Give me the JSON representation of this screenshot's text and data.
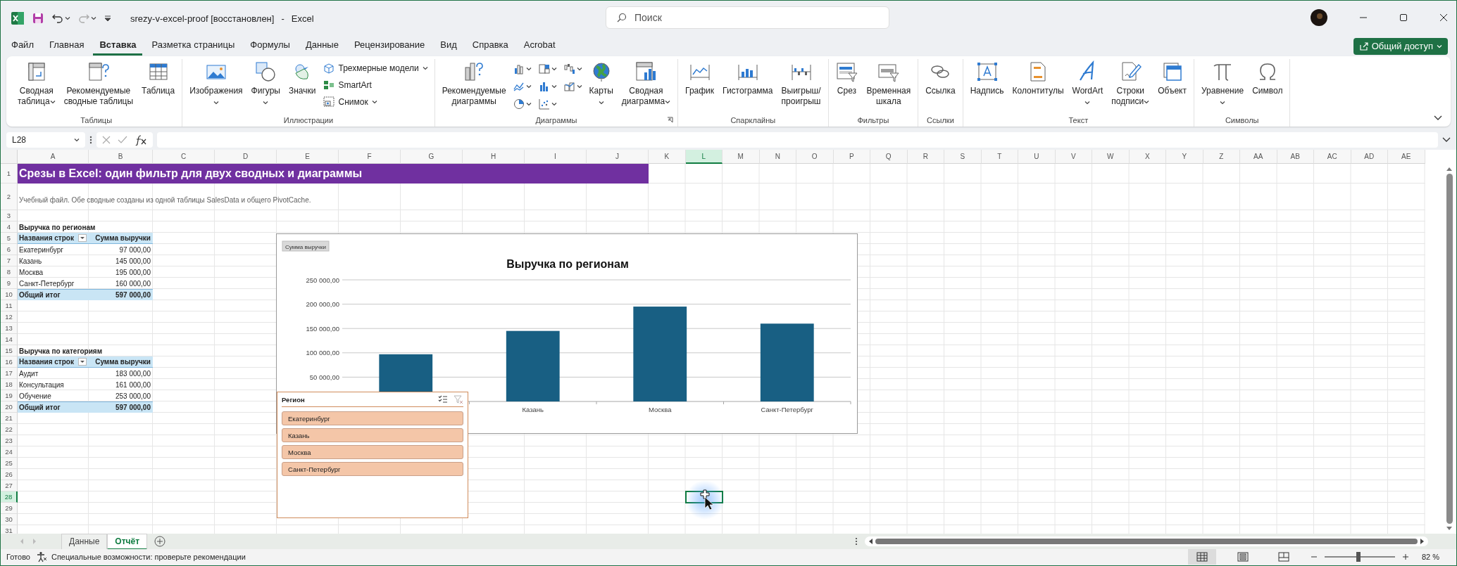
{
  "window": {
    "file_name": "srezy-v-excel-proof [восстановлен]",
    "separator": "-",
    "app_name": "Excel"
  },
  "search": {
    "placeholder": "Поиск"
  },
  "share_button": {
    "label": "Общий доступ"
  },
  "menu_tabs": [
    {
      "label": "Файл",
      "selected": false
    },
    {
      "label": "Главная",
      "selected": false
    },
    {
      "label": "Вставка",
      "selected": true
    },
    {
      "label": "Разметка страницы",
      "selected": false
    },
    {
      "label": "Формулы",
      "selected": false
    },
    {
      "label": "Данные",
      "selected": false
    },
    {
      "label": "Рецензирование",
      "selected": false
    },
    {
      "label": "Вид",
      "selected": false
    },
    {
      "label": "Справка",
      "selected": false
    },
    {
      "label": "Acrobat",
      "selected": false
    }
  ],
  "ribbon": {
    "groups": [
      {
        "label": "Таблицы",
        "launcher": false,
        "items": [
          {
            "kind": "large",
            "label": "Сводная\nтаблица",
            "dropdown": true
          },
          {
            "kind": "large",
            "label": "Рекомендуемые\nсводные таблицы",
            "dropdown": false
          },
          {
            "kind": "large",
            "label": "Таблица",
            "dropdown": false
          }
        ]
      },
      {
        "label": "Иллюстрации",
        "launcher": false,
        "items": [
          {
            "kind": "large",
            "label": "Изображения",
            "dropdown": true
          },
          {
            "kind": "large",
            "label": "Фигуры",
            "dropdown": true
          },
          {
            "kind": "large",
            "label": "Значки",
            "dropdown": false
          },
          {
            "kind": "stack",
            "items": [
              {
                "label": "Трехмерные модели",
                "dropdown": true
              },
              {
                "label": "SmartArt",
                "dropdown": false
              },
              {
                "label": "Снимок",
                "dropdown": true
              }
            ]
          }
        ]
      },
      {
        "label": "Диаграммы",
        "launcher": true,
        "items": [
          {
            "kind": "large",
            "label": "Рекомендуемые\nдиаграммы",
            "dropdown": false
          },
          {
            "kind": "icon_grid",
            "items": [
              {
                "dropdown": true
              },
              {
                "dropdown": true
              },
              {
                "dropdown": true
              },
              {
                "dropdown": true
              },
              {
                "dropdown": true
              },
              {
                "dropdown": true
              },
              {
                "dropdown": true
              },
              {
                "dropdown": true
              }
            ]
          },
          {
            "kind": "large",
            "label": "Карты",
            "dropdown": true
          },
          {
            "kind": "large",
            "label": "Сводная\nдиаграмма",
            "dropdown": true
          }
        ]
      },
      {
        "label": "Спарклайны",
        "launcher": false,
        "items": [
          {
            "kind": "large",
            "label": "График",
            "dropdown": false
          },
          {
            "kind": "large",
            "label": "Гистограмма",
            "dropdown": false
          },
          {
            "kind": "large",
            "label": "Выигрыш/\nпроигрыш",
            "dropdown": false
          }
        ]
      },
      {
        "label": "Фильтры",
        "launcher": false,
        "items": [
          {
            "kind": "large",
            "label": "Срез",
            "dropdown": false
          },
          {
            "kind": "large",
            "label": "Временная\nшкала",
            "dropdown": false
          }
        ]
      },
      {
        "label": "Ссылки",
        "launcher": false,
        "items": [
          {
            "kind": "large",
            "label": "Ссылка",
            "dropdown": false
          }
        ]
      },
      {
        "label": "Текст",
        "launcher": false,
        "items": [
          {
            "kind": "large",
            "label": "Надпись",
            "dropdown": false
          },
          {
            "kind": "large",
            "label": "Колонтитулы",
            "dropdown": false
          },
          {
            "kind": "large",
            "label": "WordArt",
            "dropdown": true
          },
          {
            "kind": "large",
            "label": "Строки\nподписи",
            "dropdown": true
          },
          {
            "kind": "large",
            "label": "Объект",
            "dropdown": false
          }
        ]
      },
      {
        "label": "Символы",
        "launcher": false,
        "items": [
          {
            "kind": "large",
            "label": "Уравнение",
            "dropdown": true
          },
          {
            "kind": "large",
            "label": "Символ",
            "dropdown": false
          }
        ]
      }
    ]
  },
  "formula_bar": {
    "name_box": "L28"
  },
  "columns": [
    {
      "label": "A",
      "selected": false
    },
    {
      "label": "B",
      "selected": false
    },
    {
      "label": "C",
      "selected": false
    },
    {
      "label": "D",
      "selected": false
    },
    {
      "label": "E",
      "selected": false
    },
    {
      "label": "F",
      "selected": false
    },
    {
      "label": "G",
      "selected": false
    },
    {
      "label": "H",
      "selected": false
    },
    {
      "label": "I",
      "selected": false
    },
    {
      "label": "J",
      "selected": false
    },
    {
      "label": "K",
      "selected": false
    },
    {
      "label": "L",
      "selected": true
    },
    {
      "label": "M",
      "selected": false
    },
    {
      "label": "N",
      "selected": false
    },
    {
      "label": "O",
      "selected": false
    },
    {
      "label": "P",
      "selected": false
    },
    {
      "label": "Q",
      "selected": false
    },
    {
      "label": "R",
      "selected": false
    },
    {
      "label": "S",
      "selected": false
    },
    {
      "label": "T",
      "selected": false
    },
    {
      "label": "U",
      "selected": false
    },
    {
      "label": "V",
      "selected": false
    },
    {
      "label": "W",
      "selected": false
    },
    {
      "label": "X",
      "selected": false
    },
    {
      "label": "Y",
      "selected": false
    },
    {
      "label": "Z",
      "selected": false
    },
    {
      "label": "AA",
      "selected": false
    },
    {
      "label": "AB",
      "selected": false
    },
    {
      "label": "AC",
      "selected": false
    },
    {
      "label": "AD",
      "selected": false
    },
    {
      "label": "AE",
      "selected": false
    }
  ],
  "rows": [
    {
      "label": "1",
      "selected": false
    },
    {
      "label": "2",
      "selected": false
    },
    {
      "label": "3",
      "selected": false
    },
    {
      "label": "4",
      "selected": false
    },
    {
      "label": "5",
      "selected": false
    },
    {
      "label": "6",
      "selected": false
    },
    {
      "label": "7",
      "selected": false
    },
    {
      "label": "8",
      "selected": false
    },
    {
      "label": "9",
      "selected": false
    },
    {
      "label": "10",
      "selected": false
    },
    {
      "label": "11",
      "selected": false
    },
    {
      "label": "12",
      "selected": false
    },
    {
      "label": "13",
      "selected": false
    },
    {
      "label": "14",
      "selected": false
    },
    {
      "label": "15",
      "selected": false
    },
    {
      "label": "16",
      "selected": false
    },
    {
      "label": "17",
      "selected": false
    },
    {
      "label": "18",
      "selected": false
    },
    {
      "label": "19",
      "selected": false
    },
    {
      "label": "20",
      "selected": false
    },
    {
      "label": "21",
      "selected": false
    },
    {
      "label": "22",
      "selected": false
    },
    {
      "label": "23",
      "selected": false
    },
    {
      "label": "24",
      "selected": false
    },
    {
      "label": "25",
      "selected": false
    },
    {
      "label": "26",
      "selected": false
    },
    {
      "label": "27",
      "selected": false
    },
    {
      "label": "28",
      "selected": true
    },
    {
      "label": "29",
      "selected": false
    },
    {
      "label": "30",
      "selected": false
    },
    {
      "label": "31",
      "selected": false
    }
  ],
  "sheet": {
    "title": "Срезы в Excel: один фильтр для двух сводных и диаграммы",
    "subtitle": "Учебный файл. Обе сводные созданы из одной таблицы SalesData и общего PivotCache.",
    "pivot_tables": [
      {
        "title": "Выручка по регионам",
        "headers": [
          "Названия строк",
          "Сумма выручки"
        ],
        "rows": [
          {
            "label": "Екатеринбург",
            "value": "97 000,00"
          },
          {
            "label": "Казань",
            "value": "145 000,00"
          },
          {
            "label": "Москва",
            "value": "195 000,00"
          },
          {
            "label": "Санкт-Петербург",
            "value": "160 000,00"
          }
        ],
        "total": {
          "label": "Общий итог",
          "value": "597 000,00"
        }
      },
      {
        "title": "Выручка по категориям",
        "headers": [
          "Названия строк",
          "Сумма выручки"
        ],
        "rows": [
          {
            "label": "Аудит",
            "value": "183 000,00"
          },
          {
            "label": "Консультация",
            "value": "161 000,00"
          },
          {
            "label": "Обучение",
            "value": "253 000,00"
          }
        ],
        "total": {
          "label": "Общий итог",
          "value": "597 000,00"
        }
      }
    ]
  },
  "chart": {
    "chart_data": {
      "type": "bar",
      "title": "Выручка по регионам",
      "grid": true,
      "categories": [
        null,
        "Казань",
        "Москва",
        "Санкт-Петербург"
      ],
      "series": [
        {
          "name": "Сумма выручки",
          "color": "#185f83",
          "values": [
            97000,
            145000,
            195000,
            160000
          ]
        }
      ],
      "ylim": [
        0,
        250000
      ],
      "yticks": [
        {
          "value": 50000,
          "label": "50 000,00"
        },
        {
          "value": 100000,
          "label": "100 000,00"
        },
        {
          "value": 150000,
          "label": "150 000,00"
        },
        {
          "value": 200000,
          "label": "200 000,00"
        },
        {
          "value": 250000,
          "label": "250 000,00"
        }
      ]
    }
  },
  "slicer": {
    "title": "Регион",
    "items": [
      {
        "label": "Екатеринбург",
        "selected": true
      },
      {
        "label": "Казань",
        "selected": true
      },
      {
        "label": "Москва",
        "selected": true
      },
      {
        "label": "Санкт-Петербург",
        "selected": true
      }
    ]
  },
  "sheet_tabs": [
    {
      "label": "Данные",
      "selected": false
    },
    {
      "label": "Отчёт",
      "selected": true
    }
  ],
  "status_bar": {
    "status": "Готово",
    "accessibility": "Специальные возможности: проверьте рекомендации",
    "views": [
      {
        "selected": true
      },
      {
        "selected": false
      },
      {
        "selected": false
      }
    ],
    "zoom": {
      "level": 0.48,
      "reading": "82 %"
    }
  }
}
